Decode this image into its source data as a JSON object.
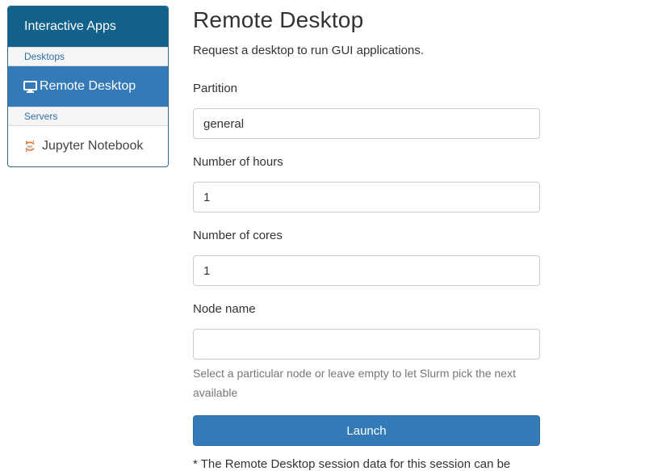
{
  "sidebar": {
    "header": "Interactive Apps",
    "groups": [
      {
        "label": "Desktops",
        "items": [
          {
            "label": "Remote Desktop",
            "icon": "monitor-icon",
            "active": true
          }
        ]
      },
      {
        "label": "Servers",
        "items": [
          {
            "label": "Jupyter Notebook",
            "icon": "jupyter-icon",
            "active": false
          }
        ]
      }
    ]
  },
  "main": {
    "title": "Remote Desktop",
    "description": "Request a desktop to run GUI applications.",
    "fields": {
      "partition": {
        "label": "Partition",
        "value": "general"
      },
      "hours": {
        "label": "Number of hours",
        "value": "1"
      },
      "cores": {
        "label": "Number of cores",
        "value": "1"
      },
      "node": {
        "label": "Node name",
        "value": "",
        "help": "Select a particular node or leave empty to let Slurm pick the next available"
      }
    },
    "launch_label": "Launch",
    "footnote": "* The Remote Desktop session data for this session can be"
  },
  "colors": {
    "sidebar_header": "#11618b",
    "primary": "#337ab7",
    "group_text": "#2f6fa5",
    "help_text": "#777777"
  }
}
